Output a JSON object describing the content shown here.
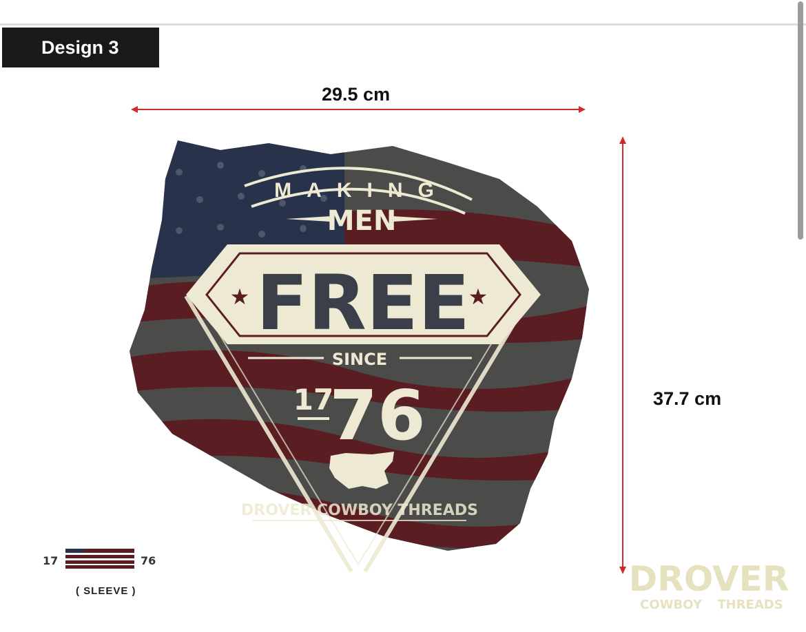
{
  "design": {
    "label": "Design 3"
  },
  "dimensions": {
    "width_label": "29.5 cm",
    "height_label": "37.7 cm"
  },
  "artwork": {
    "word_making": "MAKING",
    "word_men": "MEN",
    "word_free": "FREE",
    "word_since": "SINCE",
    "year_prefix": "17",
    "year_suffix": "76",
    "brand_line": "DROVER COWBOY THREADS"
  },
  "sleeve": {
    "year_left": "17",
    "year_right": "76",
    "caption": "( SLEEVE )"
  },
  "watermark": {
    "brand": "DROVER",
    "sub_left": "COWBOY",
    "sub_right": "THREADS"
  },
  "colors": {
    "arrow_red": "#d22b2b",
    "cream": "#ede9d2",
    "navy": "#28324a",
    "maroon": "#5a1e22",
    "gray_stripe": "#5c5e5b",
    "watermark_cream": "#e6e2bf"
  }
}
